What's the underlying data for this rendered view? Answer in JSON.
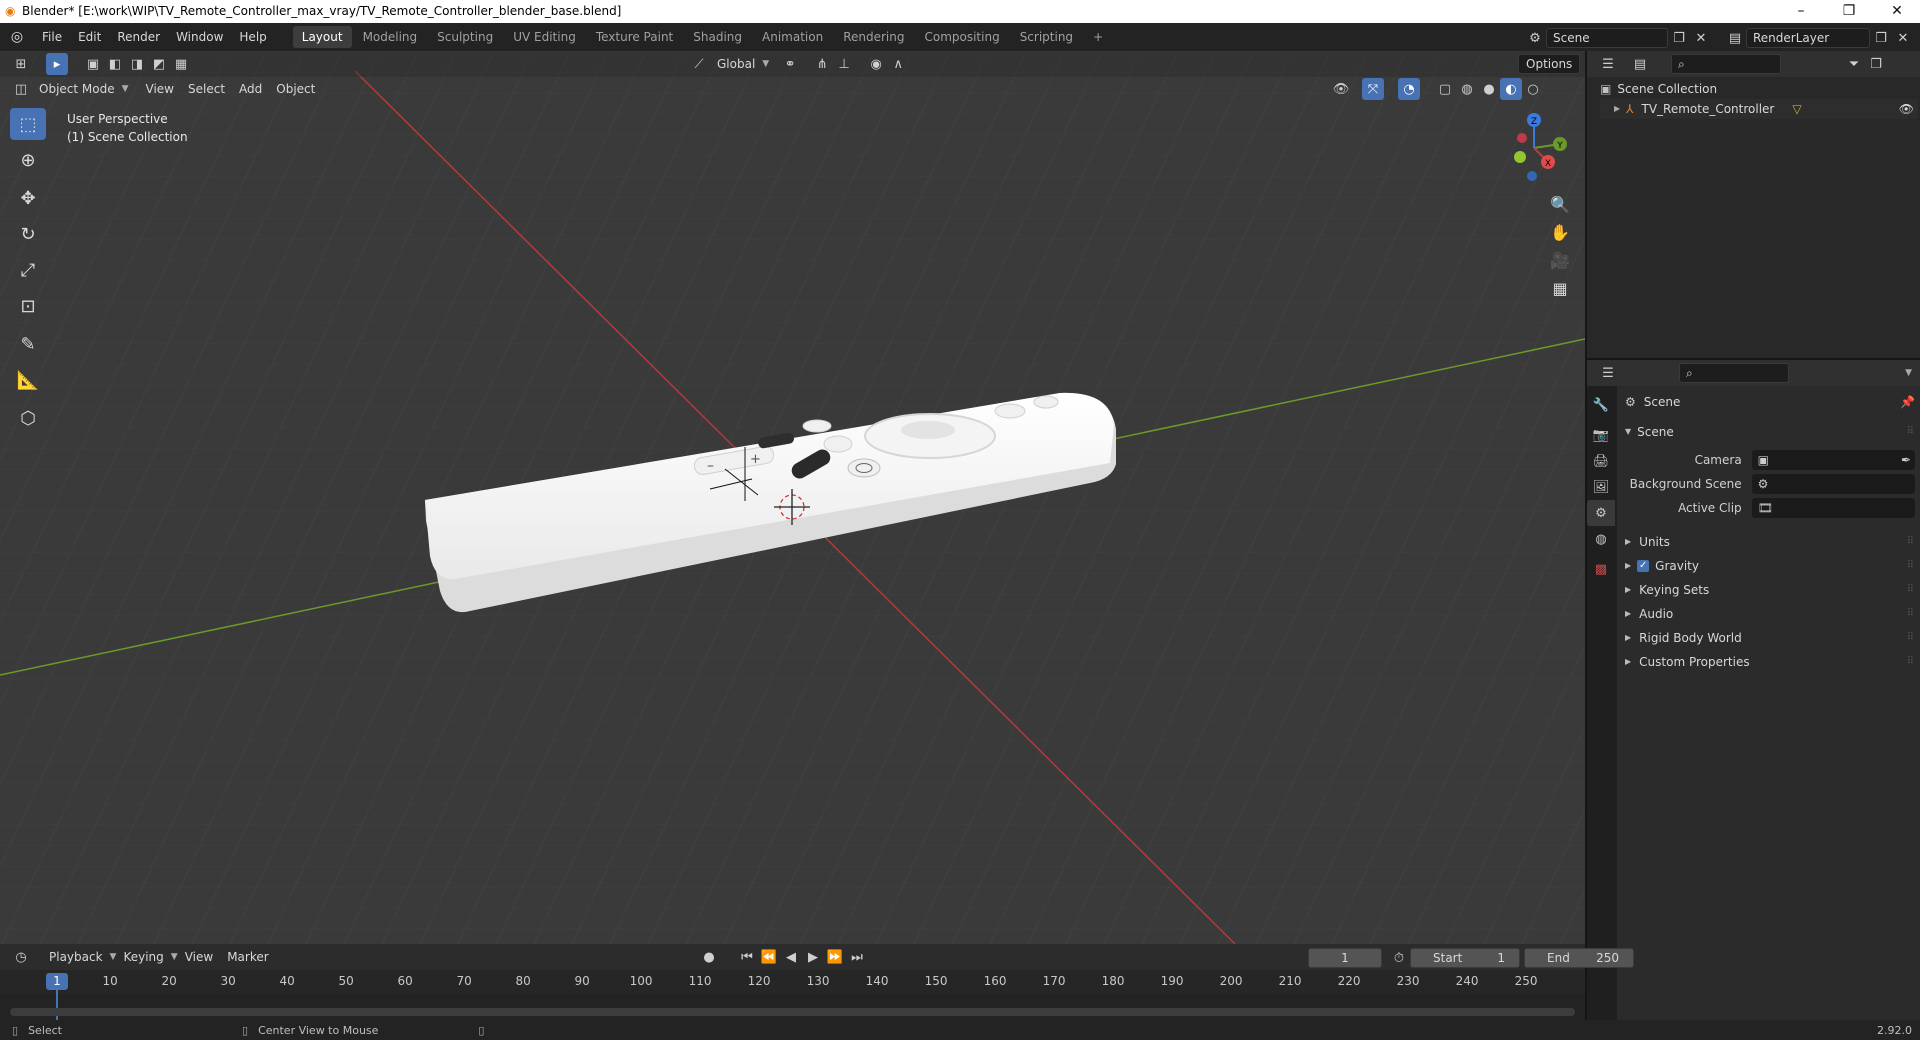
{
  "window": {
    "title": "Blender* [E:\\work\\WIP\\TV_Remote_Controller_max_vray/TV_Remote_Controller_blender_base.blend]",
    "minimize": "–",
    "maximize": "❐",
    "close": "✕"
  },
  "menu": [
    "File",
    "Edit",
    "Render",
    "Window",
    "Help"
  ],
  "workspaces": [
    "Layout",
    "Modeling",
    "Sculpting",
    "UV Editing",
    "Texture Paint",
    "Shading",
    "Animation",
    "Rendering",
    "Compositing",
    "Scripting"
  ],
  "workspace_add": "+",
  "scene_name": "Scene",
  "view_layer": "RenderLayer",
  "viewport": {
    "transform_orientation": "Global",
    "options_label": "Options",
    "mode": "Object Mode",
    "header_menu": [
      "View",
      "Select",
      "Add",
      "Object"
    ],
    "info_line1": "User Perspective",
    "info_line2": "(1) Scene Collection",
    "gizmo_axes": {
      "z": "Z",
      "y": "Y",
      "x": "X"
    }
  },
  "outliner": {
    "root": "Scene Collection",
    "items": [
      {
        "name": "TV_Remote_Controller"
      }
    ]
  },
  "properties": {
    "context": "Scene",
    "panel_title": "Scene",
    "fields": [
      {
        "label": "Camera"
      },
      {
        "label": "Background Scene"
      },
      {
        "label": "Active Clip"
      }
    ],
    "panels": [
      "Units",
      "Gravity",
      "Keying Sets",
      "Audio",
      "Rigid Body World",
      "Custom Properties"
    ],
    "gravity_checked": true
  },
  "timeline": {
    "menu": [
      "Playback",
      "Keying",
      "View",
      "Marker"
    ],
    "current_frame": "1",
    "start_label": "Start",
    "start": "1",
    "end_label": "End",
    "end": "250",
    "ticks": [
      "1",
      "10",
      "20",
      "30",
      "40",
      "50",
      "60",
      "70",
      "80",
      "90",
      "100",
      "110",
      "120",
      "130",
      "140",
      "150",
      "160",
      "170",
      "180",
      "190",
      "200",
      "210",
      "220",
      "230",
      "240",
      "250"
    ]
  },
  "statusbar": {
    "left": "Select",
    "middle": "Center View to Mouse",
    "version": "2.92.0"
  },
  "colors": {
    "accent": "#4772b3",
    "x_axis": "#c03a3a",
    "y_axis": "#6a9a2a",
    "z_axis": "#3b7be0"
  }
}
